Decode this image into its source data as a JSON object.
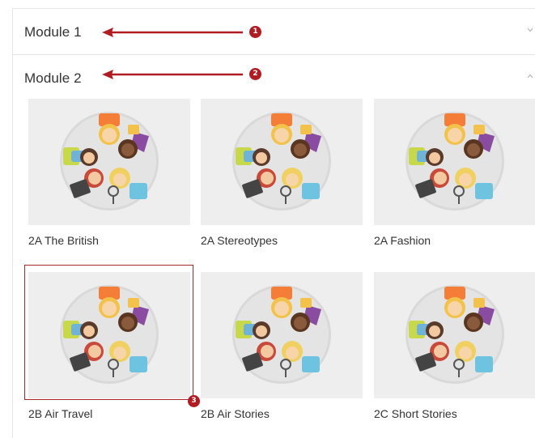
{
  "modules": [
    {
      "title": "Module 1",
      "badge": "1",
      "chevron": "chevron-down"
    },
    {
      "title": "Module 2",
      "badge": "2",
      "chevron": "chevron-up"
    }
  ],
  "cards": [
    {
      "label": "2A The British"
    },
    {
      "label": "2A Stereotypes"
    },
    {
      "label": "2A Fashion"
    },
    {
      "label": "2B Air Travel"
    },
    {
      "label": "2B Air Stories"
    },
    {
      "label": "2C Short Stories"
    }
  ],
  "highlight_badge": "3",
  "colors": {
    "annotation": "#b01c22",
    "card_bg": "#eeeeee",
    "border": "#e6e6e6"
  },
  "thumbnail_icon": "kids-circle-illustration"
}
